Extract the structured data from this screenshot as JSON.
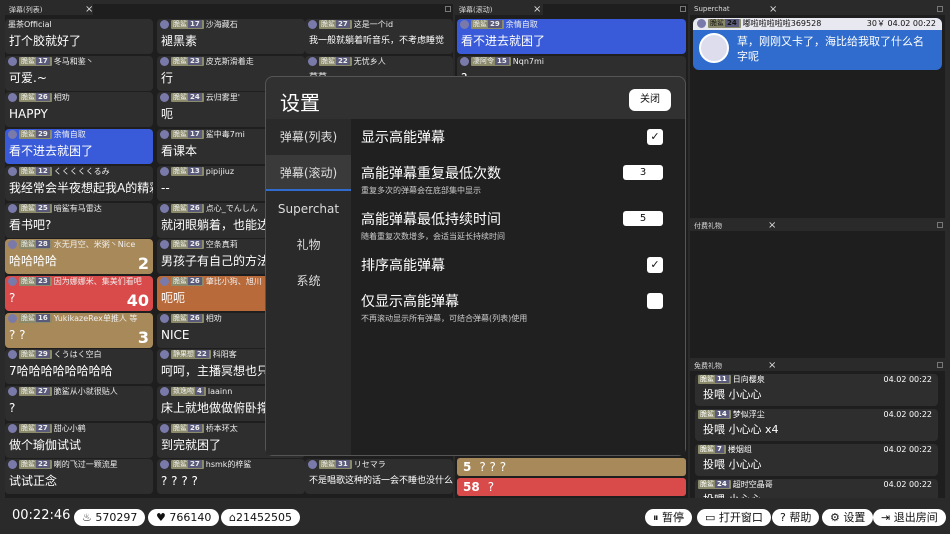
{
  "panels": {
    "list_title": "弹幕(列表)",
    "scroll_title": "弹幕(滚动)",
    "superchat_title": "Superchat",
    "paid_gift_title": "付费礼物",
    "free_gift_title": "免费礼物",
    "close_glyph": "×"
  },
  "col1": [
    {
      "hdr": "墨茶Official",
      "msg": "打个胶就好了"
    },
    {
      "badge": "脆鲨",
      "lvl": "17",
      "hdr": "冬马和鉴丶",
      "msg": "可爱.~"
    },
    {
      "badge": "脆鲨",
      "lvl": "26",
      "hdr": "相劝",
      "msg": "HAPPY"
    },
    {
      "badge": "脆鲨",
      "lvl": "29",
      "hdr": "余情自取",
      "msg": "看不进去就困了",
      "hl": "blue"
    },
    {
      "badge": "脆鲨",
      "lvl": "12",
      "hdr": "くくくくくるみ",
      "msg": "我经常会半夜想起我A的精彩操作睡不着"
    },
    {
      "badge": "脆鲨",
      "lvl": "25",
      "hdr": "暗鲨有马雷达",
      "msg": "看书吧?"
    },
    {
      "badge": "脆鲨",
      "lvl": "28",
      "hdr": "水无月空、米粥丶Nice",
      "msg": "哈哈哈哈",
      "cnt": "2",
      "hl": "tan"
    },
    {
      "badge": "脆鲨",
      "lvl": "23",
      "hdr": "因为娜娜米、集美们看吧",
      "msg": "?",
      "cnt": "40",
      "hl": "red"
    },
    {
      "badge": "脆鲨",
      "lvl": "16",
      "hdr": "YukikazeRex单推人 等",
      "msg": "? ?",
      "cnt": "3",
      "hl": "tan"
    },
    {
      "badge": "脆鲨",
      "lvl": "29",
      "hdr": "くうはく空白",
      "msg": "7哈哈哈哈哈哈哈哈"
    },
    {
      "badge": "脆鲨",
      "lvl": "27",
      "hdr": "脆鲨从小就很贴人",
      "msg": "?"
    },
    {
      "badge": "脆鲨",
      "lvl": "27",
      "hdr": "甜心小鹤",
      "msg": "做个瑜伽试试"
    },
    {
      "badge": "脆鲨",
      "lvl": "22",
      "hdr": "喇的飞过一颗流星",
      "msg": "试试正念"
    }
  ],
  "col2": [
    {
      "badge": "脆鲨",
      "lvl": "17",
      "hdr": "沙海藏石",
      "msg": "褪黑素"
    },
    {
      "badge": "脆鲨",
      "lvl": "23",
      "hdr": "皮克斯滑着走",
      "msg": "行"
    },
    {
      "badge": "脆鲨",
      "lvl": "24",
      "hdr": "云归雾里'",
      "msg": "呃"
    },
    {
      "badge": "脆鲨",
      "lvl": "17",
      "hdr": "鲨中毒7mi",
      "msg": "看课本"
    },
    {
      "badge": "脆鲨",
      "lvl": "13",
      "hdr": "pipijiuz",
      "msg": "--"
    },
    {
      "badge": "脆鲨",
      "lvl": "26",
      "hdr": "点心_でんしん",
      "msg": "就闭眼躺着，也能达到休息的"
    },
    {
      "badge": "脆鲨",
      "lvl": "26",
      "hdr": "空条真莉",
      "msg": "男孩子有自己的方法，女生就"
    },
    {
      "badge": "脆鲨",
      "lvl": "26",
      "hdr": "肇比小狗、旭川",
      "msg": "呃呃",
      "hl": "orange"
    },
    {
      "badge": "脆鲨",
      "lvl": "26",
      "hdr": "相劝",
      "msg": "NICE"
    },
    {
      "badge": "静果想",
      "lvl": "22",
      "hdr": "科阳客",
      "msg": "呵呵，主播冥想也只会越来"
    },
    {
      "badge": "致逸吻",
      "lvl": "4",
      "hdr": "laainn",
      "msg": "床上就地做做俯卧撑"
    },
    {
      "badge": "脆鲨",
      "lvl": "26",
      "hdr": "桥本环太",
      "msg": "到完就困了"
    },
    {
      "badge": "脆鲨",
      "lvl": "27",
      "hdr": "hsmk的梓鲨",
      "msg": "? ? ? ?"
    }
  ],
  "col3": [
    {
      "badge": "脆鲨",
      "lvl": "27",
      "hdr": "这是一个id",
      "msg": "我一般就躺着听音乐，不考虑睡觉"
    },
    {
      "badge": "脆鲨",
      "lvl": "22",
      "hdr": "无忧乡人",
      "msg": "草草"
    },
    {
      "badge": "脆鲨",
      "lvl": "31",
      "hdr": "リセマラ",
      "msg": "不是唱歌这种的话一会不睡也没什么"
    }
  ],
  "col4": [
    {
      "badge": "脆鲨",
      "lvl": "29",
      "hdr": "余情自取",
      "msg": "看不进去就困了",
      "hl": "blue"
    },
    {
      "badge": "凄阿令",
      "lvl": "15",
      "hdr": "Nqn7mi",
      "msg": "?"
    }
  ],
  "col4_bottom": [
    {
      "cnt": "5",
      "msg": "? ? ?",
      "hl": "tan"
    },
    {
      "cnt": "58",
      "msg": "?",
      "hl": "red"
    }
  ],
  "superchat": {
    "badge": "脆鲨",
    "lvl": "24",
    "user": "嘟啦啦啦啦啦369528",
    "price": "30￥ 04.02 00:22",
    "msg": "草，刚刚又卡了，海比给我取了什么名字呢"
  },
  "free_gifts": [
    {
      "badge": "脆鲨",
      "lvl": "11",
      "user": "日向樱泉",
      "time": "04.02 00:22",
      "msg": "投喂 小心心"
    },
    {
      "badge": "脆鲨",
      "lvl": "14",
      "user": "梦似浮尘",
      "time": "04.02 00:22",
      "msg": "投喂 小心心 x4"
    },
    {
      "badge": "脆鲨",
      "lvl": "7",
      "user": "楼烟组",
      "time": "04.02 00:22",
      "msg": "投喂 小心心"
    },
    {
      "badge": "脆鲨",
      "lvl": "24",
      "user": "超时空晶哥",
      "time": "04.02 00:22",
      "msg": "投喂 小心心"
    }
  ],
  "settings": {
    "title": "设置",
    "close": "关闭",
    "tabs": [
      "弹幕(列表)",
      "弹幕(滚动)",
      "Superchat",
      "礼物",
      "系统"
    ],
    "opt1": "显示高能弹幕",
    "opt2": "高能弹幕重复最低次数",
    "opt2_desc": "重复多次的弹幕会在底部集中显示",
    "opt2_val": "3",
    "opt3": "高能弹幕最低持续时间",
    "opt3_desc": "随着重复次数增多，会适当延长持续时间",
    "opt3_val": "5",
    "opt4": "排序高能弹幕",
    "opt5": "仅显示高能弹幕",
    "opt5_desc": "不再滚动显示所有弹幕，可结合弹幕(列表)使用",
    "check": "✓"
  },
  "bottom": {
    "time": "00:22:46",
    "fire": "570297",
    "heart": "766140",
    "home": "21452505",
    "pause": "暂停",
    "open": "打开窗口",
    "help": "帮助",
    "settings": "设置",
    "exit": "退出房间"
  }
}
